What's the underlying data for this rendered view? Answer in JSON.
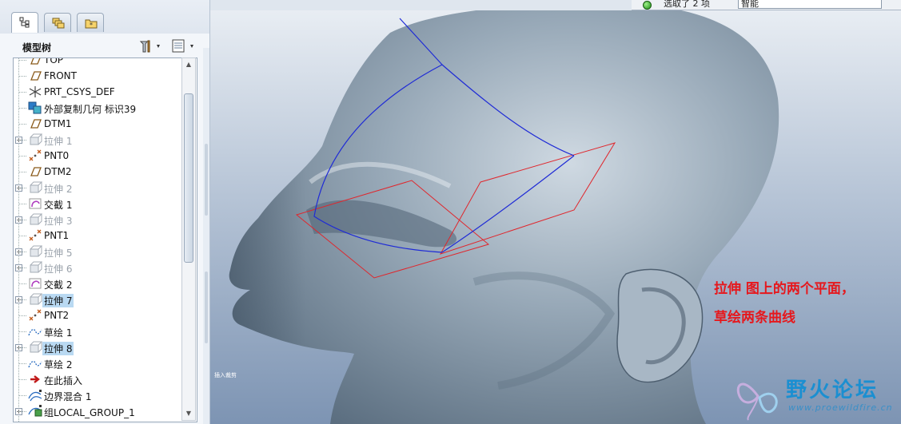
{
  "panel": {
    "tabs": [
      {
        "icon": "model-tree-icon",
        "active": true
      },
      {
        "icon": "layers-icon",
        "active": false
      },
      {
        "icon": "favorites-folder-icon",
        "active": false
      }
    ],
    "title": "模型树",
    "settings_icon": "tree-settings-icon",
    "columns_icon": "tree-columns-icon"
  },
  "tree": {
    "items": [
      {
        "label": "TOP",
        "icon": "datum-plane-icon",
        "expandable": false,
        "state": "normal"
      },
      {
        "label": "FRONT",
        "icon": "datum-plane-icon",
        "expandable": false,
        "state": "normal"
      },
      {
        "label": "PRT_CSYS_DEF",
        "icon": "csys-icon",
        "expandable": false,
        "state": "normal"
      },
      {
        "label": "外部复制几何 标识39",
        "icon": "copy-geometry-icon",
        "expandable": false,
        "state": "normal"
      },
      {
        "label": "DTM1",
        "icon": "datum-plane-icon",
        "expandable": false,
        "state": "normal"
      },
      {
        "label": "拉伸 1",
        "icon": "extrude-icon",
        "expandable": true,
        "state": "suppressed"
      },
      {
        "label": "PNT0",
        "icon": "datum-point-icon",
        "expandable": false,
        "state": "normal"
      },
      {
        "label": "DTM2",
        "icon": "datum-plane-icon",
        "expandable": false,
        "state": "normal"
      },
      {
        "label": "拉伸 2",
        "icon": "extrude-icon",
        "expandable": true,
        "state": "suppressed"
      },
      {
        "label": "交截 1",
        "icon": "intersect-icon",
        "expandable": false,
        "state": "normal"
      },
      {
        "label": "拉伸 3",
        "icon": "extrude-icon",
        "expandable": true,
        "state": "suppressed"
      },
      {
        "label": "PNT1",
        "icon": "datum-point-icon",
        "expandable": false,
        "state": "normal"
      },
      {
        "label": "拉伸 5",
        "icon": "extrude-icon",
        "expandable": true,
        "state": "suppressed"
      },
      {
        "label": "拉伸 6",
        "icon": "extrude-icon",
        "expandable": true,
        "state": "suppressed"
      },
      {
        "label": "交截 2",
        "icon": "intersect-icon",
        "expandable": false,
        "state": "normal"
      },
      {
        "label": "拉伸 7",
        "icon": "extrude-icon",
        "expandable": true,
        "state": "selected"
      },
      {
        "label": "PNT2",
        "icon": "datum-point-icon",
        "expandable": false,
        "state": "normal"
      },
      {
        "label": "草绘 1",
        "icon": "sketch-icon",
        "expandable": false,
        "state": "normal"
      },
      {
        "label": "拉伸 8",
        "icon": "extrude-icon",
        "expandable": true,
        "state": "selected"
      },
      {
        "label": "草绘 2",
        "icon": "sketch-icon",
        "expandable": false,
        "state": "normal"
      },
      {
        "label": "在此插入",
        "icon": "insert-here-arrow-icon",
        "expandable": false,
        "state": "normal"
      },
      {
        "label": "边界混合 1",
        "icon": "boundary-blend-icon",
        "expandable": false,
        "state": "normal"
      },
      {
        "label": "组LOCAL_GROUP_1",
        "icon": "group-icon",
        "expandable": true,
        "state": "normal"
      }
    ]
  },
  "status": {
    "selected_text": "选取了 2 项",
    "filter_value": "智能"
  },
  "viewport": {
    "annotation_line1": "拉伸 图上的两个平面，",
    "annotation_line2": "草绘两条曲线",
    "corner_label": "插入裁剪",
    "colors": {
      "annotation": "#e6171c",
      "curve_blue": "#1f2bd6",
      "plane_red": "#e0262c"
    }
  },
  "watermark": {
    "title": "野火论坛",
    "url": "www.proewildfire.cn"
  }
}
